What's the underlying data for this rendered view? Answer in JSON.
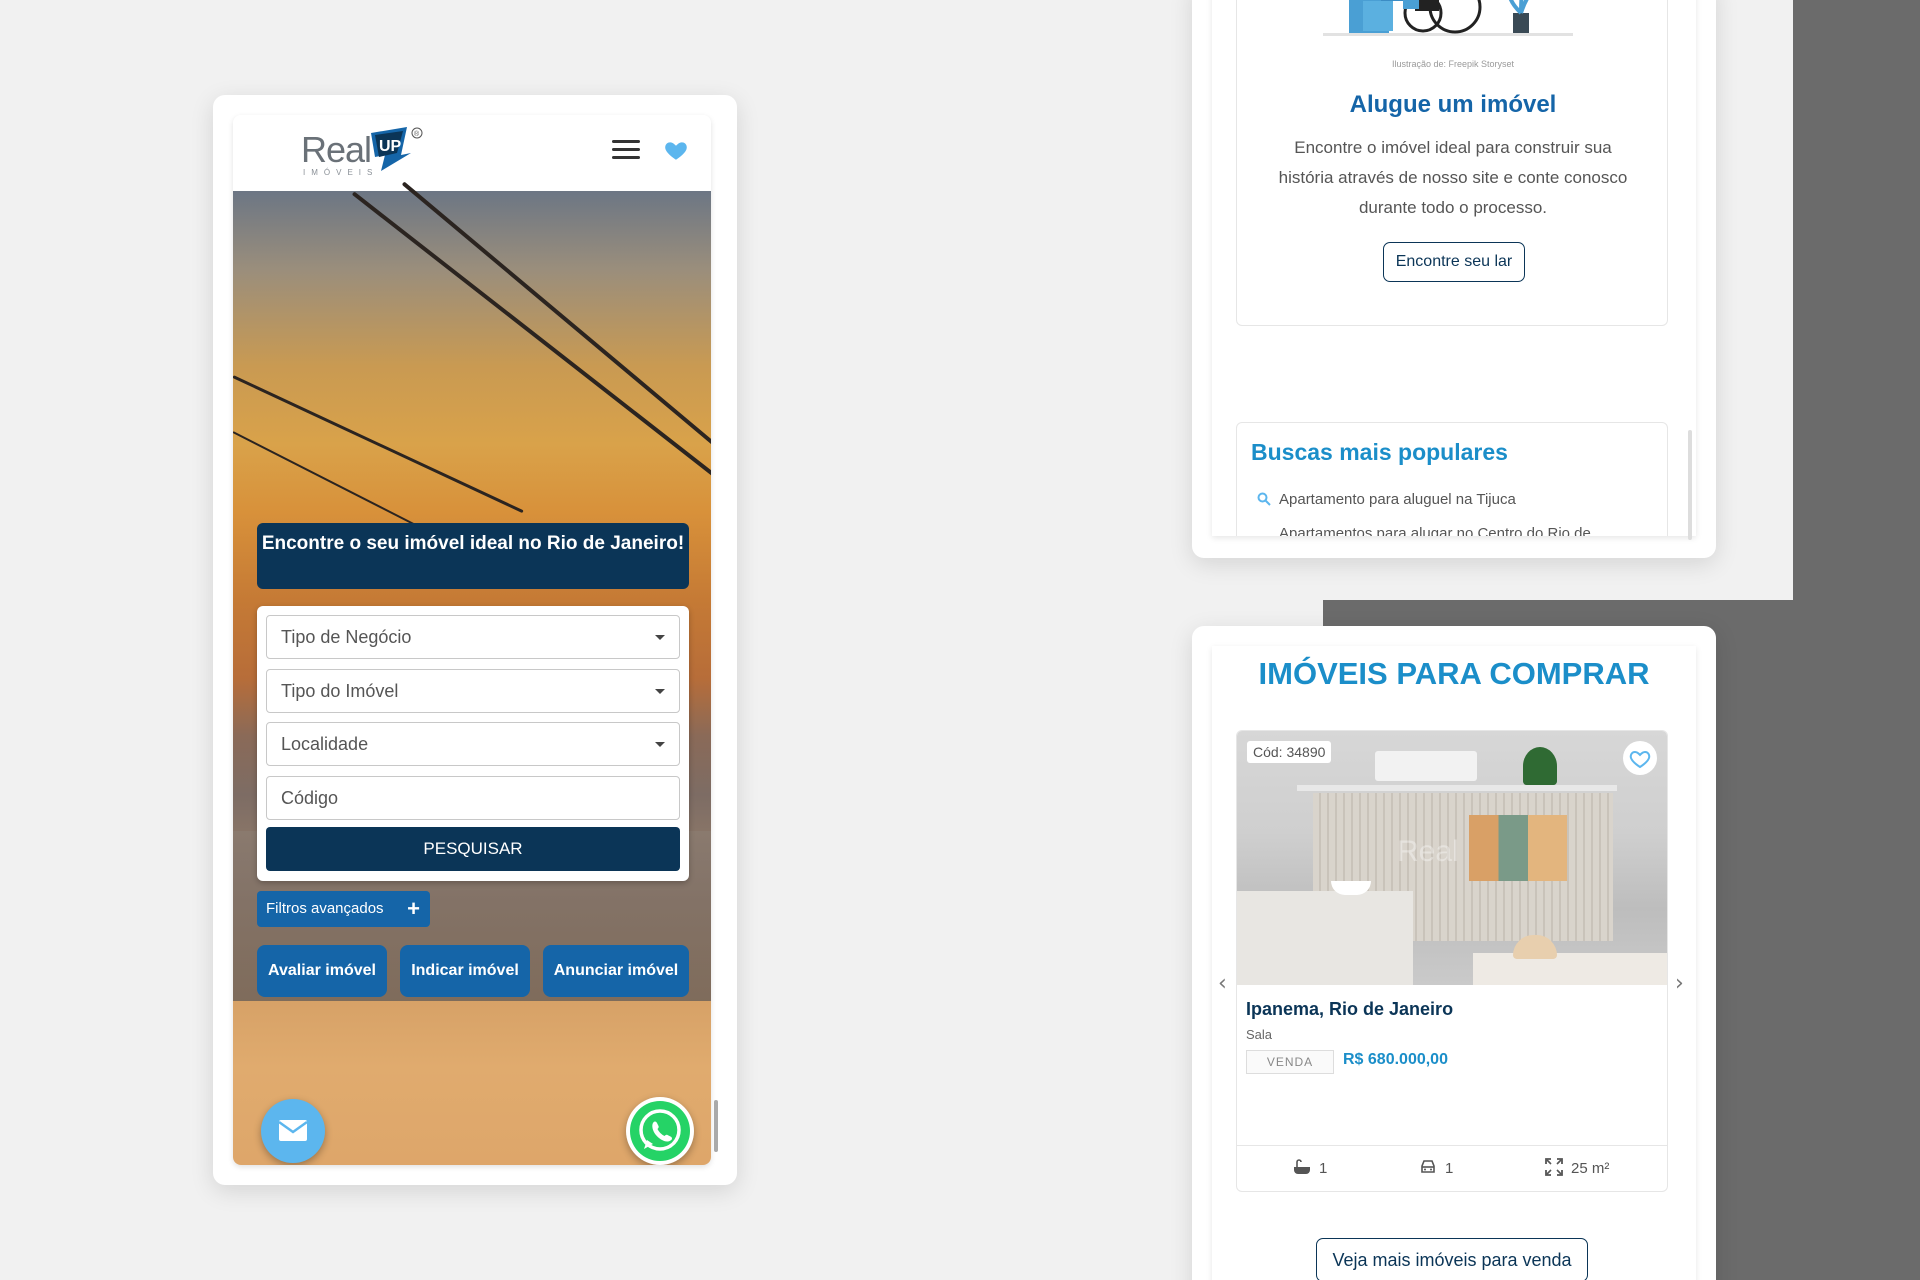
{
  "colors": {
    "navy": "#0b3557",
    "blue": "#1565a8",
    "light_blue": "#1b8ec9",
    "sky": "#5cb6ee",
    "whatsapp": "#25d366"
  },
  "phone1": {
    "logo": {
      "text": "Real",
      "mark_text": "UP",
      "sub": "IMÓVEIS",
      "reg": "®"
    },
    "header_icons": [
      "menu-icon",
      "heart-icon"
    ],
    "hero_title": "Encontre o seu imóvel ideal no Rio de Janeiro!",
    "search": {
      "business_type": "Tipo de Negócio",
      "property_type": "Tipo do Imóvel",
      "location": "Localidade",
      "code_placeholder": "Código",
      "submit": "PESQUISAR"
    },
    "advanced_filters": "Filtros avançados",
    "advanced_filters_icon": "+",
    "actions": [
      "Avaliar imóvel",
      "Indicar imóvel",
      "Anunciar imóvel"
    ],
    "floating": [
      "mail-icon",
      "whatsapp-icon"
    ]
  },
  "phone2": {
    "illustration_credit": "Ilustração de: Freepik Storyset",
    "rent": {
      "title": "Alugue um imóvel",
      "text": "Encontre o imóvel ideal para construir sua história através de nosso site e conte conosco durante todo o processo.",
      "button": "Encontre seu lar"
    },
    "popular": {
      "title": "Buscas mais populares",
      "items": [
        "Apartamento para aluguel na Tijuca",
        "Apartamentos para alugar no Centro do Rio de"
      ]
    }
  },
  "phone3": {
    "title": "IMÓVEIS PARA COMPRAR",
    "listing": {
      "code": "Cód: 34890",
      "location": "Ipanema, Rio de Janeiro",
      "type": "Sala",
      "tag": "VENDA",
      "price": "R$ 680.000,00",
      "bathrooms": "1",
      "parking": "1",
      "area": "25 m²",
      "image_watermark": "Real"
    },
    "carousel_prev": "‹",
    "carousel_next": "›",
    "more_button": "Veja mais imóveis para venda"
  }
}
